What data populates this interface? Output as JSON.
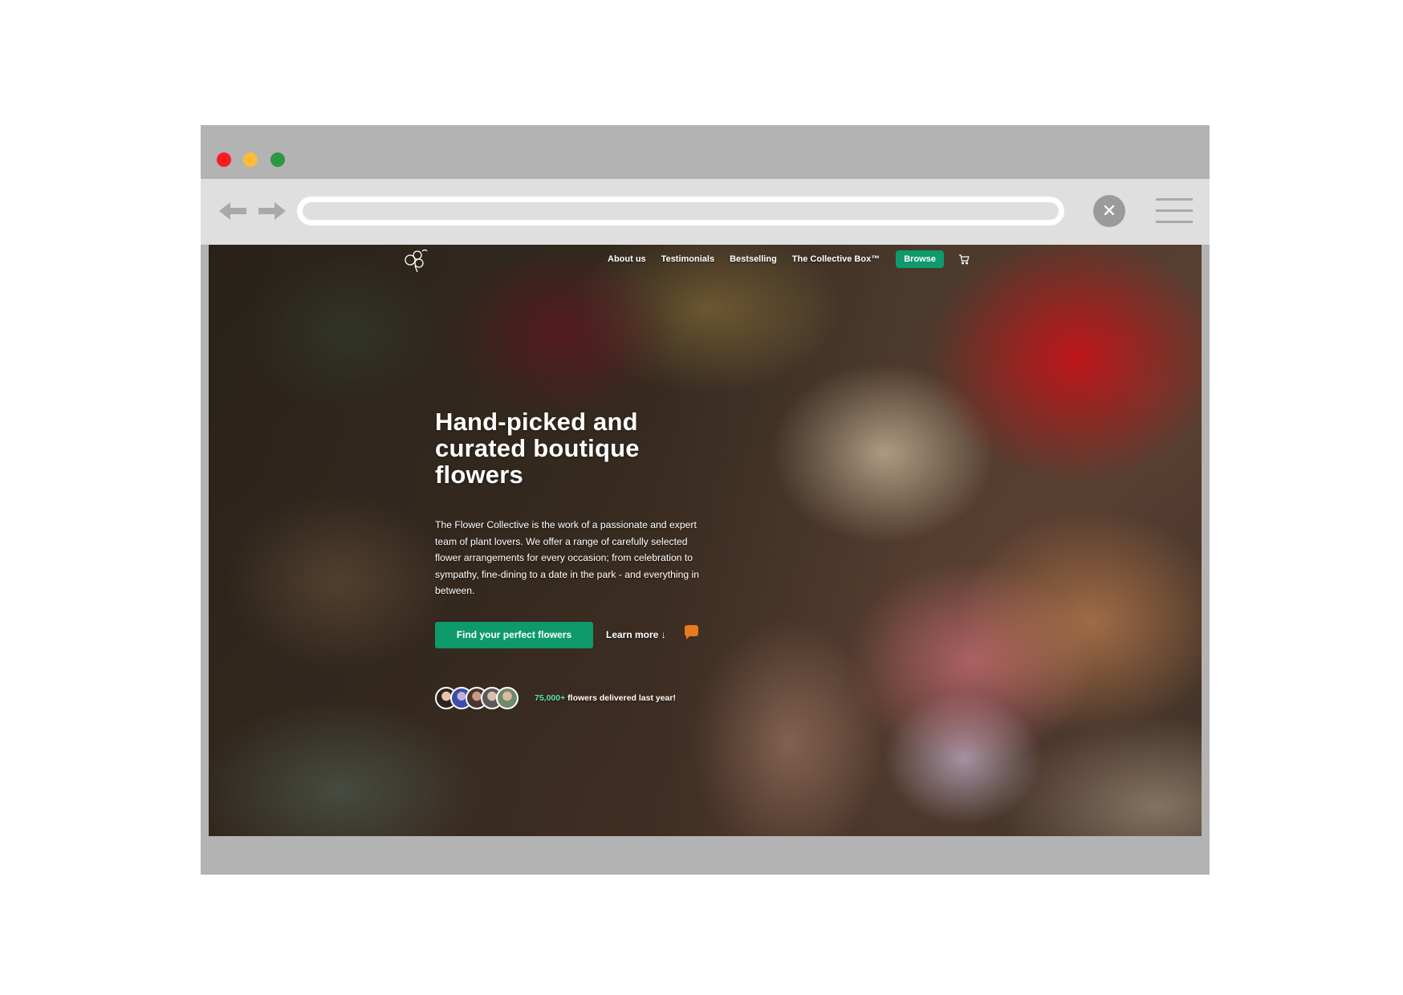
{
  "window": {
    "controls": [
      {
        "name": "close-window-dot",
        "color": "#ff1a22"
      },
      {
        "name": "minimize-window-dot",
        "color": "#ffbc3a"
      },
      {
        "name": "maximize-window-dot",
        "color": "#2e9644"
      }
    ]
  },
  "toolbar": {
    "back_icon": "arrow-left-icon",
    "forward_icon": "arrow-right-icon",
    "address_value": "",
    "close_label": "✕",
    "menu_icon": "hamburger-menu-icon"
  },
  "site": {
    "logo_icon": "flower-logo-icon",
    "nav": {
      "links": [
        "About us",
        "Testimonials",
        "Bestselling",
        "The Collective Box™"
      ],
      "browse_label": "Browse",
      "cart_icon": "cart-icon"
    },
    "hero": {
      "title": "Hand-picked and curated boutique flowers",
      "body": "The Flower Collective is the work of a passionate and expert team of plant lovers. We offer a range of carefully selected flower arrangements for every occasion; from celebration to sympathy, fine-dining to a date in the park - and everything in between.",
      "cta_primary": "Find your perfect flowers",
      "cta_secondary": "Learn more ↓",
      "social_proof": {
        "count": "75,000+",
        "text": " flowers delivered last year!"
      }
    }
  },
  "colors": {
    "brand_green": "#0e9a6a",
    "accent_mint": "#5ee3b3",
    "chrome_gray": "#b3b3b3",
    "toolbar_gray": "#dfdfdf"
  }
}
